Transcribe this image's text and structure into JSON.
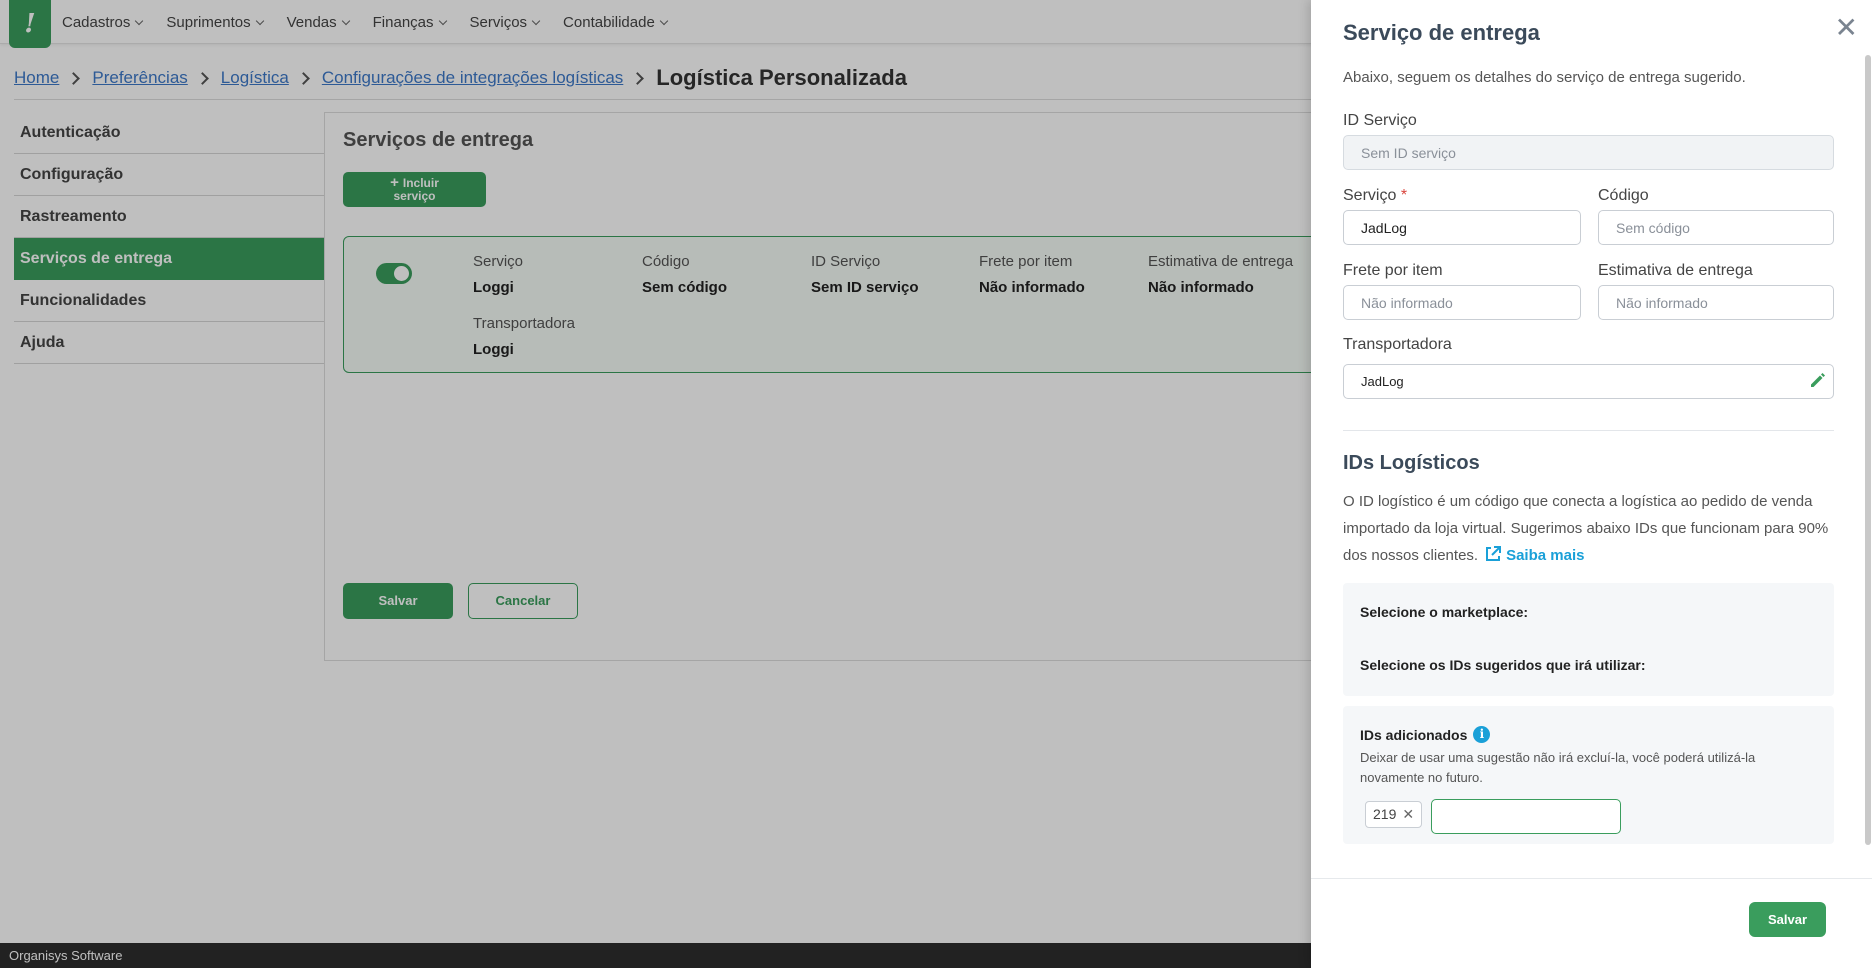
{
  "nav": {
    "logo": "!",
    "menu": [
      "Cadastros",
      "Suprimentos",
      "Vendas",
      "Finanças",
      "Serviços",
      "Contabilidade"
    ]
  },
  "breadcrumb": {
    "items": [
      "Home",
      "Preferências",
      "Logística",
      "Configurações de integrações logísticas"
    ],
    "current": "Logística Personalizada"
  },
  "sidebar": {
    "items": [
      "Autenticação",
      "Configuração",
      "Rastreamento",
      "Serviços de entrega",
      "Funcionalidades",
      "Ajuda"
    ]
  },
  "content": {
    "title": "Serviços de entrega",
    "add_button": {
      "line1": "Incluir",
      "line2": "serviço"
    },
    "card": {
      "fields": [
        {
          "label": "Serviço",
          "value": "Loggi"
        },
        {
          "label": "Código",
          "value": "Sem código"
        },
        {
          "label": "ID Serviço",
          "value": "Sem ID serviço"
        },
        {
          "label": "Frete por item",
          "value": "Não informado"
        },
        {
          "label": "Estimativa de entrega",
          "value": "Não informado"
        },
        {
          "label": "Transportadora",
          "value": "Loggi"
        }
      ]
    },
    "save": "Salvar",
    "cancel": "Cancelar"
  },
  "footer": {
    "text": "Organisys Software"
  },
  "drawer": {
    "title": "Serviço de entrega",
    "close": "✕",
    "subtitle": "Abaixo, seguem os detalhes do serviço de entrega sugerido.",
    "id_servico": {
      "label": "ID Serviço",
      "placeholder": "Sem ID serviço"
    },
    "servico": {
      "label": "Serviço",
      "required": "*",
      "value": "JadLog"
    },
    "codigo": {
      "label": "Código",
      "placeholder": "Sem código"
    },
    "frete": {
      "label": "Frete por item",
      "placeholder": "Não informado"
    },
    "estimativa": {
      "label": "Estimativa de entrega",
      "placeholder": "Não informado"
    },
    "transportadora": {
      "label": "Transportadora",
      "value": "JadLog"
    },
    "ids_title": "IDs Logísticos",
    "ids_desc": "O ID logístico é um código que conecta a logística ao pedido de venda importado da loja virtual. Sugerimos abaixo IDs que funcionam para 90% dos nossos clientes.",
    "saiba_mais": "Saiba mais",
    "marketplace_label": "Selecione o marketplace:",
    "sugeridos_label": "Selecione os IDs sugeridos que irá utilizar:",
    "adicionados_title": "IDs adicionados",
    "info_glyph": "i",
    "adicionados_desc": "Deixar de usar uma sugestão não irá excluí-la, você poderá utilizá-la novamente no futuro.",
    "chip_value": "219",
    "chip_remove": "✕",
    "save": "Salvar"
  }
}
